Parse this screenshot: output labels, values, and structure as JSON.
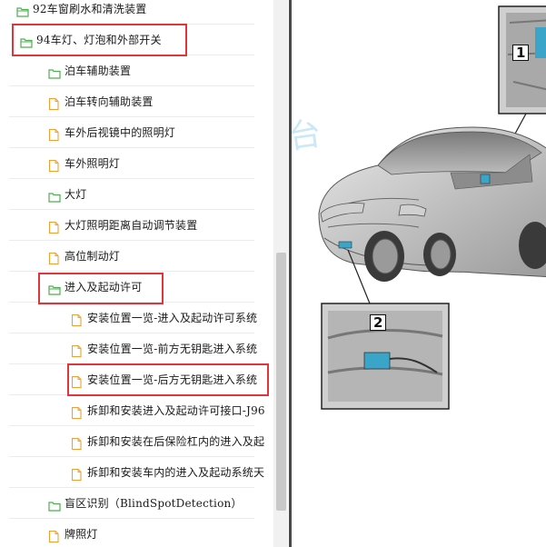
{
  "tree": {
    "items": [
      {
        "label": "92车窗刷水和清洗装置",
        "icon": "folder-open-icon"
      },
      {
        "label": "94车灯、灯泡和外部开关",
        "icon": "folder-open-icon"
      },
      {
        "label": "泊车辅助装置",
        "icon": "folder-icon"
      },
      {
        "label": "泊车转向辅助装置",
        "icon": "document-icon"
      },
      {
        "label": "车外后视镜中的照明灯",
        "icon": "document-icon"
      },
      {
        "label": "车外照明灯",
        "icon": "document-icon"
      },
      {
        "label": "大灯",
        "icon": "folder-icon"
      },
      {
        "label": "大灯照明距离自动调节装置",
        "icon": "document-icon"
      },
      {
        "label": "高位制动灯",
        "icon": "document-icon"
      },
      {
        "label": "进入及起动许可",
        "icon": "folder-open-icon"
      },
      {
        "label": "安装位置一览-进入及起动许可系统",
        "icon": "document-icon"
      },
      {
        "label": "安装位置一览-前方无钥匙进入系统",
        "icon": "document-icon"
      },
      {
        "label": "安装位置一览-后方无钥匙进入系统",
        "icon": "document-icon"
      },
      {
        "label": "拆卸和安装进入及起动许可接口-J96",
        "icon": "document-icon"
      },
      {
        "label": "拆卸和安装在后保险杠内的进入及起",
        "icon": "document-icon"
      },
      {
        "label": "拆卸和安装车内的进入及起动系统天",
        "icon": "document-icon"
      },
      {
        "label": "盲区识别（BlindSpotDetection）",
        "icon": "folder-icon"
      },
      {
        "label": "牌照灯",
        "icon": "document-icon"
      }
    ]
  },
  "document": {
    "watermark": "台",
    "callouts": [
      "1",
      "2"
    ]
  },
  "colors": {
    "highlight": "#e0353b",
    "folder": "#4caf50",
    "document": "#f0a030"
  }
}
